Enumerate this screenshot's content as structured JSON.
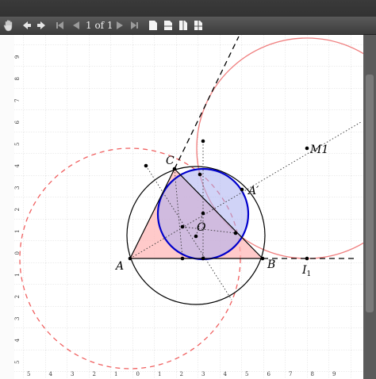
{
  "toolbar": {
    "page_indicator": "1 of 1",
    "icons": [
      "hand-icon",
      "back-icon",
      "forward-icon",
      "first-page-icon",
      "previous-page-icon",
      "next-page-icon",
      "last-page-icon",
      "single-page-icon",
      "continuous-icon",
      "facing-icon",
      "continuous-facing-icon"
    ]
  },
  "figure": {
    "points": {
      "A": "A",
      "B": "B",
      "C": "C",
      "O": "O",
      "A_prime": "A′",
      "I1_base": "I",
      "I1_sub": "1",
      "M1": "M1"
    },
    "x_ticks": [
      "5",
      "4",
      "3",
      "2",
      "1",
      "0",
      "1",
      "2",
      "3",
      "4",
      "5",
      "6",
      "7",
      "8",
      "9"
    ],
    "y_ticks": [
      "9",
      "8",
      "7",
      "6",
      "5",
      "4",
      "3",
      "2",
      "1",
      "0",
      "1",
      "2",
      "3",
      "4",
      "5"
    ],
    "colors": {
      "grid": "#cfcfcf",
      "triangle_fill": "#ffb3b3",
      "incircle_stroke": "#0000cc",
      "incircle_fill": "#a9aef0",
      "dashed_circle": "#f06060",
      "excircle": "#f08080",
      "circumcircle": "#000000"
    }
  }
}
